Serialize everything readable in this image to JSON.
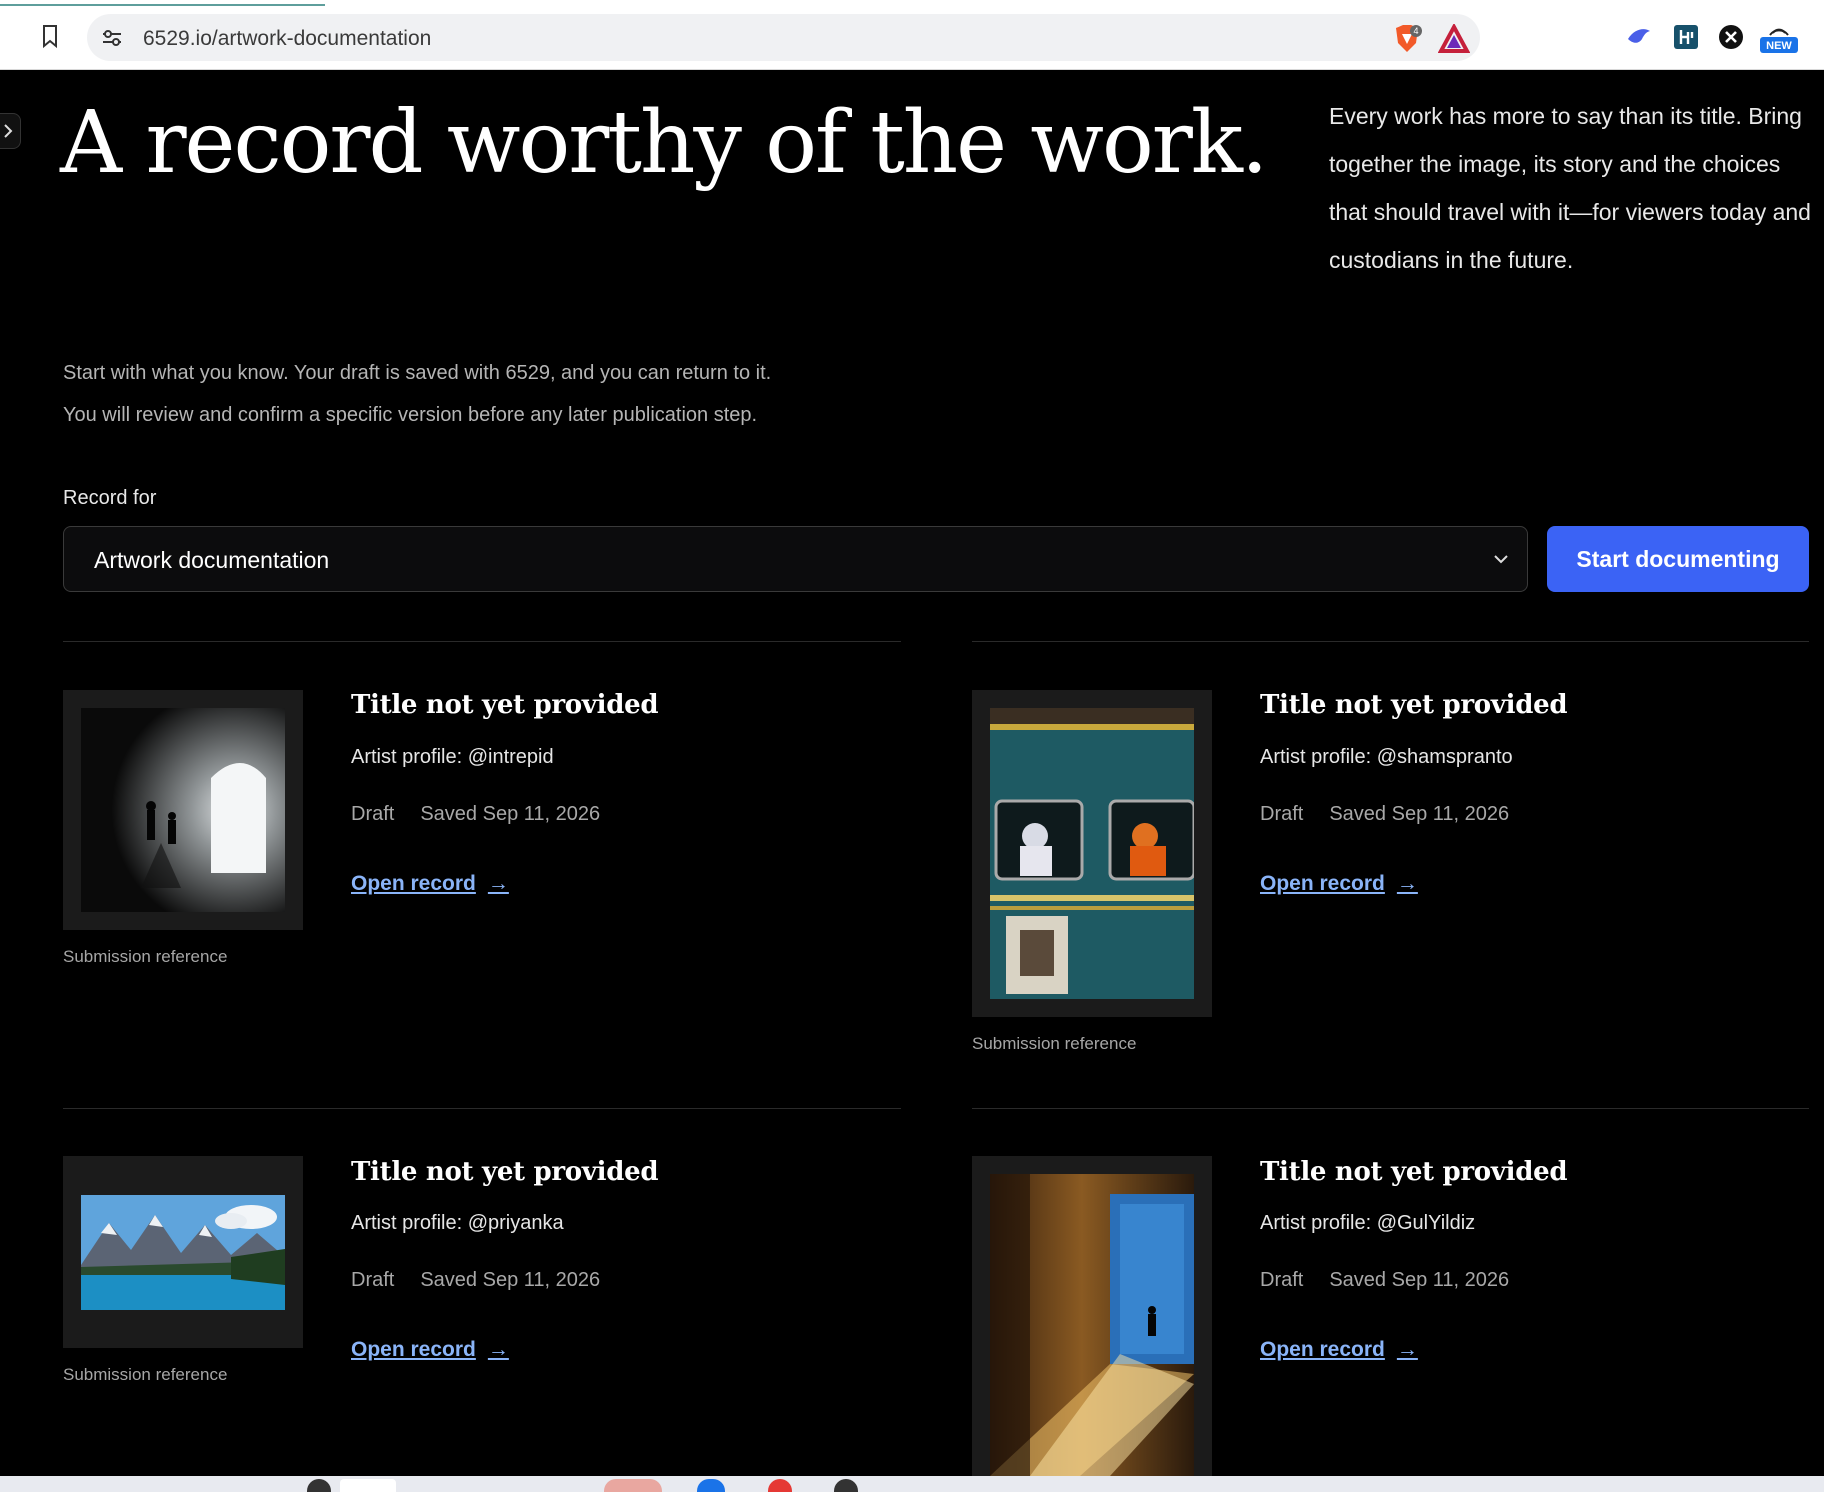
{
  "browser": {
    "url": "6529.io/artwork-documentation",
    "shield_badge": "4",
    "new_badge": "NEW"
  },
  "hero": {
    "title": "A record worthy of the work.",
    "description": "Every work has more to say than its title. Bring together the image, its story and the choices that should travel with it—for viewers today and custodians in the future."
  },
  "intro": {
    "line1": "Start with what you know. Your draft is saved with 6529, and you can return to it.",
    "line2": "You will review and confirm a specific version before any later publication step."
  },
  "record_form": {
    "label": "Record for",
    "selected": "Artwork documentation",
    "start_button": "Start documenting"
  },
  "records": [
    {
      "title": "Title not yet provided",
      "artist": "Artist profile: @intrepid",
      "status": "Draft",
      "saved": "Saved Sep 11, 2026",
      "link": "Open record",
      "arrow": "→",
      "caption": "Submission reference"
    },
    {
      "title": "Title not yet provided",
      "artist": "Artist profile: @shamspranto",
      "status": "Draft",
      "saved": "Saved Sep 11, 2026",
      "link": "Open record",
      "arrow": "→",
      "caption": "Submission reference"
    },
    {
      "title": "Title not yet provided",
      "artist": "Artist profile: @priyanka",
      "status": "Draft",
      "saved": "Saved Sep 11, 2026",
      "link": "Open record",
      "arrow": "→",
      "caption": "Submission reference"
    },
    {
      "title": "Title not yet provided",
      "artist": "Artist profile: @GulYildiz",
      "status": "Draft",
      "saved": "Saved Sep 11, 2026",
      "link": "Open record",
      "arrow": "→",
      "caption": ""
    }
  ],
  "colors": {
    "background": "#000000",
    "accent_button": "#3b63f5",
    "link": "#8ab4f8"
  }
}
